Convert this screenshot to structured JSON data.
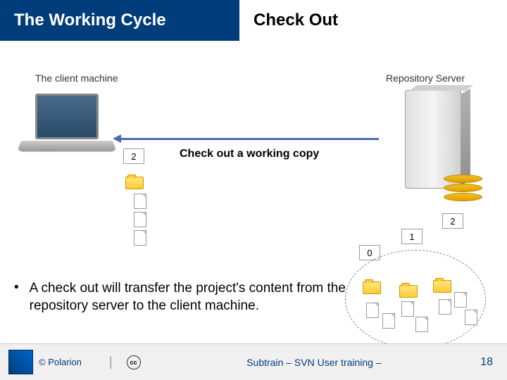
{
  "header": {
    "left": "The Working Cycle",
    "right": "Check Out"
  },
  "labels": {
    "client": "The client machine",
    "server": "Repository Server",
    "arrow": "Check out a working copy"
  },
  "revisions": {
    "client_rev": "2",
    "r0": "0",
    "r1": "1",
    "r2": "2"
  },
  "bullet": {
    "marker": "•",
    "text": "A check out will transfer the project's content from the repository server to the client machine."
  },
  "footer": {
    "copyright": "© Polarion",
    "cc": "cc",
    "title": "Subtrain – SVN User training –",
    "page": "18"
  }
}
